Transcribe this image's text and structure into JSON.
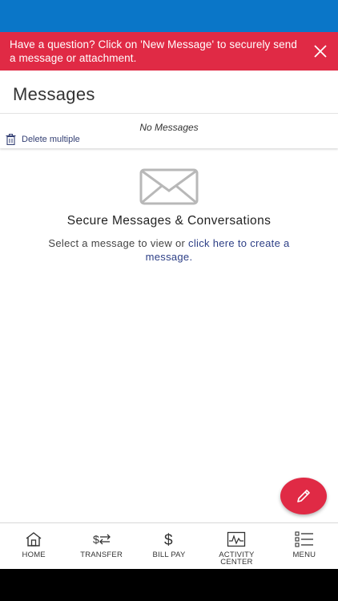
{
  "banner": {
    "text": "Have a question? Click on 'New Message' to securely send a message or attachment."
  },
  "page": {
    "title": "Messages"
  },
  "list": {
    "empty_text": "No Messages",
    "delete_multiple_label": "Delete multiple"
  },
  "empty_state": {
    "title": "Secure Messages & Conversations",
    "subtitle_prefix": "Select a message to view or ",
    "create_link": "click here to create a message."
  },
  "nav": {
    "items": [
      {
        "label": "HOME",
        "icon": "home-icon"
      },
      {
        "label": "TRANSFER",
        "icon": "transfer-icon"
      },
      {
        "label": "BILL PAY",
        "icon": "dollar-icon"
      },
      {
        "label": "ACTIVITY CENTER",
        "icon": "activity-icon"
      },
      {
        "label": "MENU",
        "icon": "menu-icon"
      }
    ]
  },
  "colors": {
    "status_bar": "#0a76c8",
    "accent_red": "#e02a45",
    "link_blue": "#2d3f86"
  }
}
